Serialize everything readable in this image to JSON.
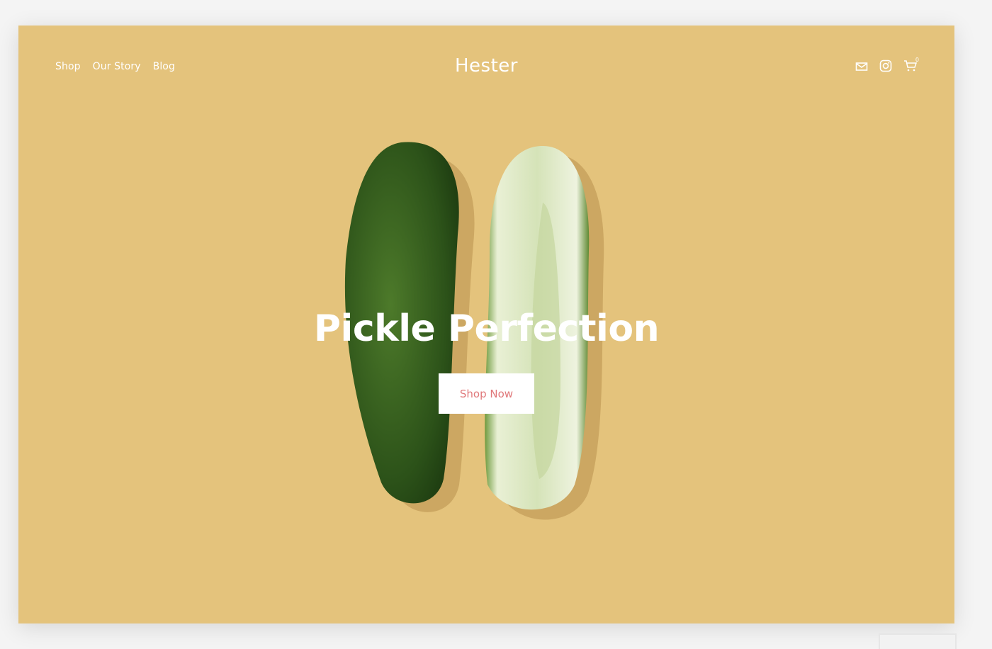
{
  "header": {
    "nav": [
      "Shop",
      "Our Story",
      "Blog"
    ],
    "logo": "Hester",
    "icons": [
      "mail-icon",
      "instagram-icon",
      "cart-icon"
    ],
    "cart_count": "0"
  },
  "hero": {
    "title": "Pickle Perfection",
    "cta_label": "Shop Now"
  },
  "colors": {
    "background": "#e4c37c",
    "cta_text": "#e0787a"
  }
}
